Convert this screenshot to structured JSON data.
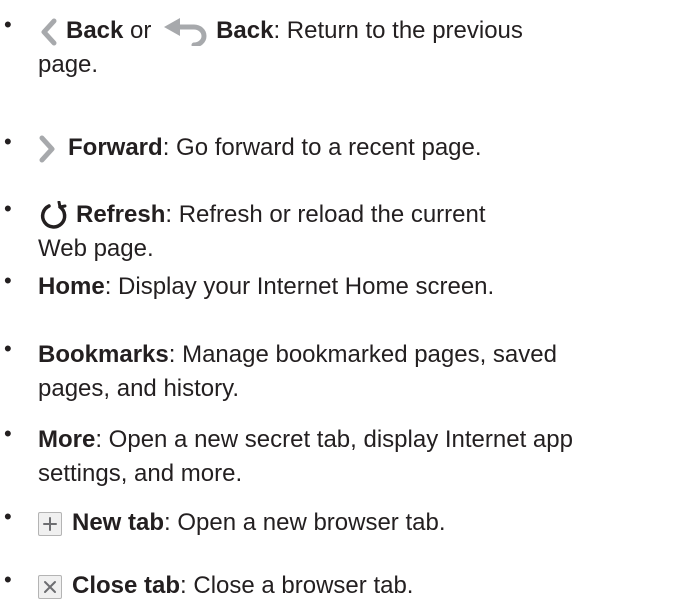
{
  "items": [
    {
      "icon_1": "chevron-left-icon",
      "term_1": "Back",
      "connector": "or",
      "icon_2": "back-arrow-icon",
      "term_2": "Back",
      "desc_line1": ": Return to the previous",
      "desc_line2": "page."
    },
    {
      "icon": "chevron-right-icon",
      "term": "Forward",
      "desc": ": Go forward to a recent page."
    },
    {
      "icon": "refresh-icon",
      "term": "Refresh",
      "desc_line1": ": Refresh or reload the current",
      "desc_line2": "Web page."
    },
    {
      "term": "Home",
      "desc": ": Display your Internet Home screen."
    },
    {
      "term": "Bookmarks",
      "desc_line1": ": Manage bookmarked pages, saved",
      "desc_line2": "pages, and history."
    },
    {
      "term": "More",
      "desc_line1": ": Open a new secret tab, display Internet app",
      "desc_line2": "settings, and more."
    },
    {
      "icon": "plus-icon",
      "term": "New tab",
      "desc": ": Open a new browser tab."
    },
    {
      "icon": "close-icon",
      "term": "Close tab",
      "desc": ": Close a browser tab."
    }
  ],
  "colors": {
    "text": "#231f20",
    "icon_grey": "#a7a9ac",
    "box_border": "#b4b4b4",
    "box_fill": "#f0f0f0"
  }
}
